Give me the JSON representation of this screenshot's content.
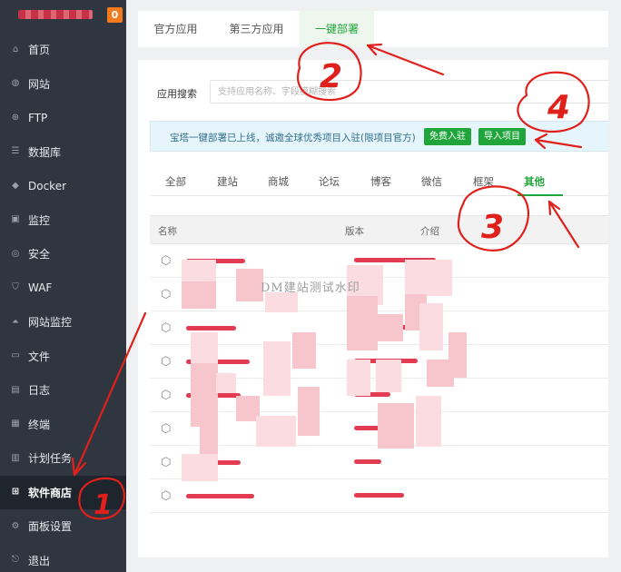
{
  "sidebar": {
    "badge": "0",
    "items": [
      {
        "label": "首页",
        "icon": "home-icon",
        "glyph": "⌂"
      },
      {
        "label": "网站",
        "icon": "globe-icon",
        "glyph": "◍"
      },
      {
        "label": "FTP",
        "icon": "ftp-icon",
        "glyph": "⊕"
      },
      {
        "label": "数据库",
        "icon": "database-icon",
        "glyph": "☰"
      },
      {
        "label": "Docker",
        "icon": "docker-icon",
        "glyph": "◆"
      },
      {
        "label": "监控",
        "icon": "monitor-icon",
        "glyph": "▣"
      },
      {
        "label": "安全",
        "icon": "shield-icon",
        "glyph": "◎"
      },
      {
        "label": "WAF",
        "icon": "waf-icon",
        "glyph": "⛉"
      },
      {
        "label": "网站监控",
        "icon": "site-monitor-icon",
        "glyph": "⏶"
      },
      {
        "label": "文件",
        "icon": "folder-icon",
        "glyph": "▭"
      },
      {
        "label": "日志",
        "icon": "log-icon",
        "glyph": "▤"
      },
      {
        "label": "终端",
        "icon": "terminal-icon",
        "glyph": "▦"
      },
      {
        "label": "计划任务",
        "icon": "task-icon",
        "glyph": "▥"
      },
      {
        "label": "软件商店",
        "icon": "app-store-icon",
        "glyph": "⊞",
        "active": true
      },
      {
        "label": "面板设置",
        "icon": "settings-icon",
        "glyph": "⚙"
      },
      {
        "label": "退出",
        "icon": "logout-icon",
        "glyph": "⎋"
      }
    ]
  },
  "top_tabs": [
    "官方应用",
    "第三方应用",
    "一键部署"
  ],
  "search": {
    "label": "应用搜索",
    "placeholder": "支持应用名称、字段模糊搜索"
  },
  "notice": {
    "text": "宝塔一键部署已上线，诚邀全球优秀项目入驻(限项目官方)",
    "free_join_button": "免费入驻",
    "import_button": "导入项目"
  },
  "category_tabs": [
    "全部",
    "建站",
    "商城",
    "论坛",
    "博客",
    "微信",
    "框架",
    "其他"
  ],
  "table": {
    "headers": {
      "name": "名称",
      "version": "版本",
      "intro": "介绍"
    },
    "row_count": 8
  },
  "watermark": "DM建站测试水印",
  "annotations": {
    "one": "1",
    "two": "2",
    "three": "3",
    "four": "4",
    "color": "#e0201b"
  },
  "colors": {
    "sidebar_bg": "#2f3640",
    "accent_green": "#20a53a",
    "badge_orange": "#f37b1d"
  }
}
